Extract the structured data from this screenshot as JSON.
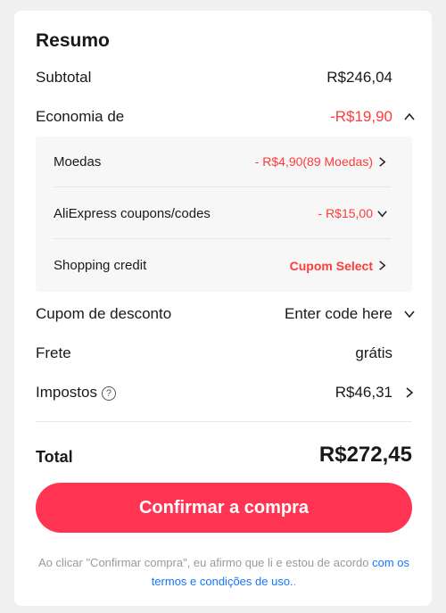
{
  "summary": {
    "title": "Resumo",
    "subtotal": {
      "label": "Subtotal",
      "value": "R$246,04"
    },
    "savings": {
      "label": "Economia de",
      "value": "-R$19,90",
      "items": [
        {
          "label": "Moedas",
          "value": "- R$4,90(89 Moedas)"
        },
        {
          "label": "AliExpress coupons/codes",
          "value": "- R$15,00"
        },
        {
          "label": "Shopping credit",
          "value": "Cupom Select"
        }
      ]
    },
    "coupon": {
      "label": "Cupom de desconto",
      "value": "Enter code here"
    },
    "shipping": {
      "label": "Frete",
      "value": "grátis"
    },
    "taxes": {
      "label": "Impostos",
      "value": "R$46,31",
      "help": "?"
    },
    "total": {
      "label": "Total",
      "value": "R$272,45"
    },
    "confirm_label": "Confirmar a compra",
    "disclaimer_prefix": "Ao clicar \"Confirmar compra\", eu afirmo que li e estou de acordo ",
    "disclaimer_link": "com os termos e condições de uso.",
    "disclaimer_suffix": "."
  },
  "colors": {
    "accent": "#ff3453",
    "discount": "#ff3b3b",
    "link": "#1677ff"
  },
  "icons": [
    "chevron-up-icon",
    "chevron-right-icon",
    "chevron-down-icon",
    "help-icon"
  ]
}
